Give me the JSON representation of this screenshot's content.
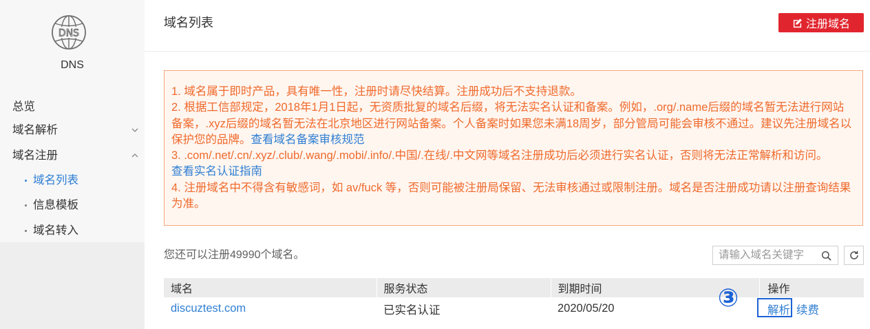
{
  "sidebar": {
    "logo_icon": "dns-globe-icon",
    "logo_text": "DNS",
    "service_name": "DNS",
    "menu": [
      {
        "label": "总览"
      },
      {
        "label": "域名解析",
        "expanded": false,
        "icon": "chevron-down-icon"
      },
      {
        "label": "域名注册",
        "expanded": true,
        "icon": "chevron-up-icon",
        "children": [
          {
            "label": "域名列表",
            "active": true
          },
          {
            "label": "信息模板"
          },
          {
            "label": "域名转入"
          }
        ]
      }
    ]
  },
  "header": {
    "title": "域名列表",
    "register_button": "注册域名",
    "register_icon": "edit-icon"
  },
  "notice": {
    "item1": "1. 域名属于即时产品，具有唯一性，注册时请尽快结算。注册成功后不支持退款。",
    "item2_lines": [
      "2. 根据工信部规定，2018年1月1日起，无资质批复的域名后缀，将无法实名认证和备案。例如，.org/.name后缀的域名暂无法进行网站",
      "备案，.xyz后缀的域名暂无法在北京地区进行网站备案。个人备案时如果您未满18周岁，部分管局可能会审核不通过。建议先注册域名以",
      "保护您的品牌。"
    ],
    "item2_link": "查看域名备案审核规范",
    "item3": "3. .com/.net/.cn/.xyz/.club/.wang/.mobi/.info/.中国/.在线/.中文网等域名注册成功后必须进行实名认证，否则将无法正常解析和访问。",
    "item3_link": "查看实名认证指南",
    "item4_lines": [
      "4. 注册域名中不得含有敏感词，如 av/fuck 等，否则可能被注册局保留、无法审核通过或限制注册。域名是否注册成功请以注册查询结果",
      "为准。"
    ]
  },
  "quota_text": "您还可以注册49990个域名。",
  "search": {
    "placeholder": "请输入域名关键字",
    "icon": "search-icon"
  },
  "refresh_icon": "refresh-icon",
  "table": {
    "columns": [
      "域名",
      "服务状态",
      "到期时间",
      "操作"
    ],
    "rows": [
      {
        "domain": "discuztest.com",
        "status": "已实名认证",
        "expiry": "2020/05/20",
        "actions": [
          "解析",
          "续费"
        ]
      }
    ]
  },
  "annotation": {
    "marker": "③"
  },
  "colors": {
    "brand_red": "#e1252e",
    "link_blue": "#2f7fd3",
    "notice_text": "#ef6a2c",
    "notice_border": "#f3a77e",
    "notice_bg": "#fff6f0",
    "annotation_blue": "#1d62d6",
    "sidebar_bg": "#f7f7f7",
    "table_header_bg": "#ebebeb"
  }
}
